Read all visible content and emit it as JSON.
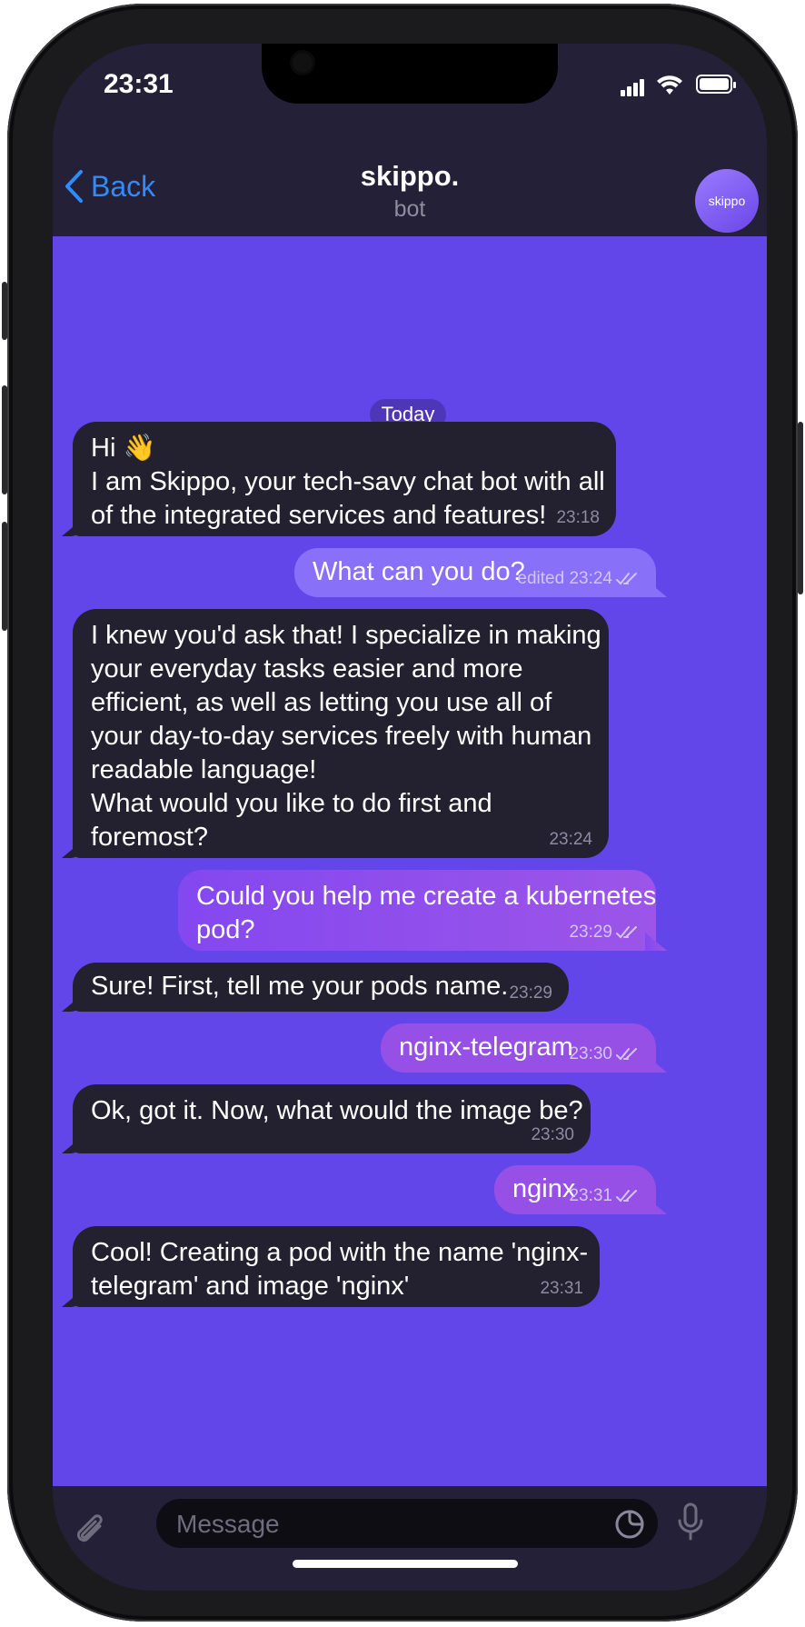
{
  "status": {
    "time": "23:31"
  },
  "header": {
    "back_label": "Back",
    "title": "skippo.",
    "subtitle": "bot",
    "avatar_text": "skippo"
  },
  "chat": {
    "date_label": "Today",
    "messages": [
      {
        "dir": "in",
        "lines": [
          "Hi 👋",
          "I am Skippo, your tech-savy chat bot with all",
          "of the integrated services and features!"
        ],
        "time": "23:18"
      },
      {
        "dir": "out",
        "lines": [
          "What can you do?"
        ],
        "edited": "edited",
        "time": "23:24"
      },
      {
        "dir": "in",
        "lines": [
          "I knew you'd ask that! I specialize in making",
          "your everyday tasks easier and more",
          "efficient, as well as letting you use all of",
          "your day-to-day services freely with human",
          "readable language!",
          "What would you like to do first and",
          "foremost?"
        ],
        "time": "23:24"
      },
      {
        "dir": "out",
        "lines": [
          "Could you help me create a kubernetes",
          "pod?"
        ],
        "time": "23:29"
      },
      {
        "dir": "in",
        "lines": [
          "Sure! First, tell me your pods name."
        ],
        "time": "23:29"
      },
      {
        "dir": "out",
        "lines": [
          "nginx-telegram"
        ],
        "time": "23:30"
      },
      {
        "dir": "in",
        "lines": [
          "Ok, got it. Now, what would the image be?"
        ],
        "time": "23:30"
      },
      {
        "dir": "out",
        "lines": [
          "nginx"
        ],
        "time": "23:31"
      },
      {
        "dir": "in",
        "lines": [
          "Cool! Creating a pod with the name 'nginx-",
          "telegram' and image 'nginx'"
        ],
        "time": "23:31"
      }
    ]
  },
  "input": {
    "placeholder": "Message"
  },
  "colors": {
    "chat_bg": "#6246ea",
    "incoming_bubble": "#23212f",
    "outgoing_bubble": "#8a5cf5",
    "link_blue": "#2e8cff"
  },
  "icons": [
    "back-chevron-icon",
    "signal-icon",
    "wifi-icon",
    "battery-icon",
    "paperclip-icon",
    "sticker-icon",
    "microphone-icon",
    "double-check-icon"
  ]
}
